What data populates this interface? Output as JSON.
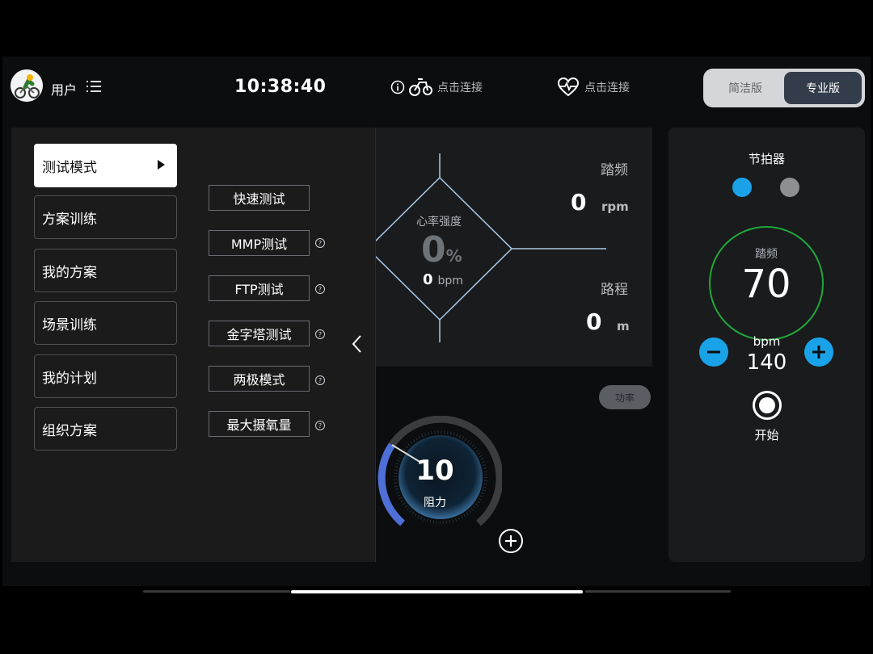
{
  "header": {
    "user_label": "用户",
    "clock": "10:38:40",
    "bike_connect": "点击连接",
    "hr_connect": "点击连接",
    "mode_simple": "简洁版",
    "mode_pro": "专业版"
  },
  "left_menu": {
    "categories": [
      "测试模式",
      "方案训练",
      "我的方案",
      "场景训练",
      "我的计划",
      "组织方案"
    ],
    "tests": [
      "快速测试",
      "MMP测试",
      "FTP测试",
      "金字塔测试",
      "两极模式",
      "最大摄氧量"
    ],
    "help_glyph": "?"
  },
  "metrics": {
    "cadence_label": "踏频",
    "cadence_value": "0",
    "cadence_unit": "rpm",
    "distance_label": "路程",
    "distance_value": "0",
    "distance_unit": "m",
    "hr_intensity_label": "心率强度",
    "hr_intensity_value": "0",
    "hr_intensity_unit": "%",
    "hr_bpm_value": "0",
    "hr_bpm_unit": "bpm"
  },
  "power_toggle": "功率",
  "resistance": {
    "value": "10",
    "label": "阻力"
  },
  "metronome": {
    "title": "节拍器",
    "cadence_label": "踏频",
    "cadence_value": "70",
    "bpm_label": "bpm",
    "bpm_value": "140",
    "start_label": "开始"
  },
  "colors": {
    "accent_blue": "#1aa2e8",
    "ring_green": "#1fa83a",
    "panel": "#191b1d"
  }
}
